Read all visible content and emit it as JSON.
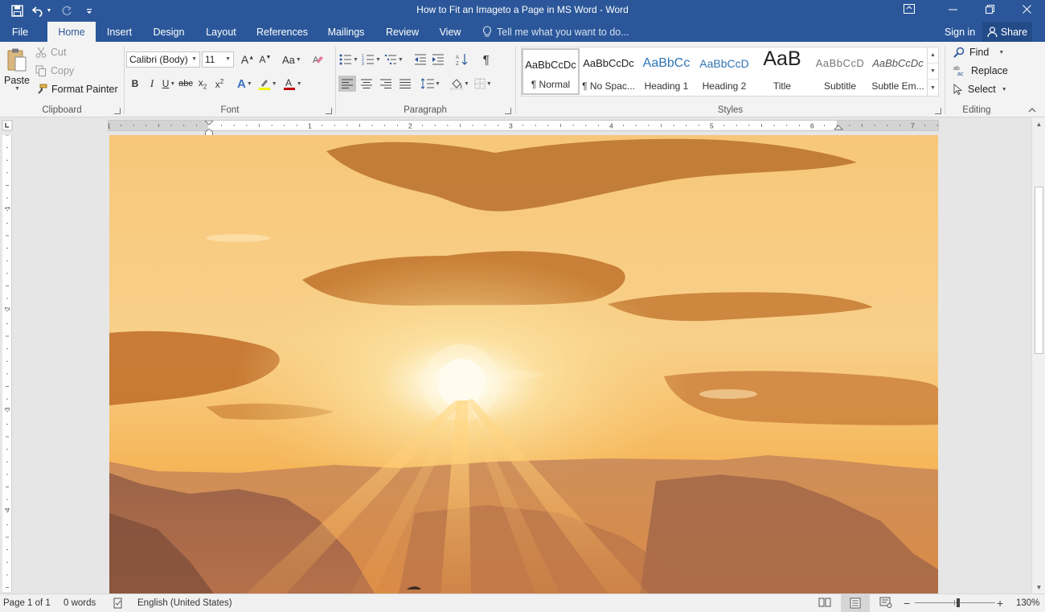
{
  "window": {
    "title": "How to Fit an Imageto a Page in MS Word - Word",
    "accent": "#2b579a"
  },
  "tabs": [
    {
      "label": "File",
      "active": false
    },
    {
      "label": "Home",
      "active": true
    },
    {
      "label": "Insert",
      "active": false
    },
    {
      "label": "Design",
      "active": false
    },
    {
      "label": "Layout",
      "active": false
    },
    {
      "label": "References",
      "active": false
    },
    {
      "label": "Mailings",
      "active": false
    },
    {
      "label": "Review",
      "active": false
    },
    {
      "label": "View",
      "active": false
    }
  ],
  "tell_me": "Tell me what you want to do...",
  "account": {
    "sign_in": "Sign in",
    "share": "Share"
  },
  "clipboard": {
    "paste": "Paste",
    "cut": "Cut",
    "copy": "Copy",
    "format_painter": "Format Painter",
    "label": "Clipboard"
  },
  "font": {
    "name": "Calibri (Body)",
    "size": "11",
    "change_case": "Aa",
    "label": "Font"
  },
  "paragraph": {
    "label": "Paragraph"
  },
  "styles": {
    "label": "Styles",
    "items": [
      {
        "sample": "AaBbCcDc",
        "name": "¶ Normal",
        "selected": true
      },
      {
        "sample": "AaBbCcDc",
        "name": "¶ No Spac...",
        "selected": false
      },
      {
        "sample": "AaBbCc",
        "name": "Heading 1",
        "selected": false
      },
      {
        "sample": "AaBbCcD",
        "name": "Heading 2",
        "selected": false
      },
      {
        "sample": "AaB",
        "name": "Title",
        "selected": false
      },
      {
        "sample": "AaBbCcD",
        "name": "Subtitle",
        "selected": false
      },
      {
        "sample": "AaBbCcDc",
        "name": "Subtle Em...",
        "selected": false
      }
    ]
  },
  "editing": {
    "find": "Find",
    "replace": "Replace",
    "select": "Select",
    "label": "Editing"
  },
  "ruler": {
    "h_numbers": [
      "1",
      "1",
      "2",
      "3",
      "4",
      "5",
      "6",
      "7"
    ],
    "v_numbers": [
      "1",
      "2",
      "3",
      "4"
    ]
  },
  "document": {
    "image_alt": "sunset over mountains"
  },
  "status": {
    "page": "Page 1 of 1",
    "words": "0 words",
    "language": "English (United States)",
    "zoom": "130%",
    "zoom_level": 130
  }
}
